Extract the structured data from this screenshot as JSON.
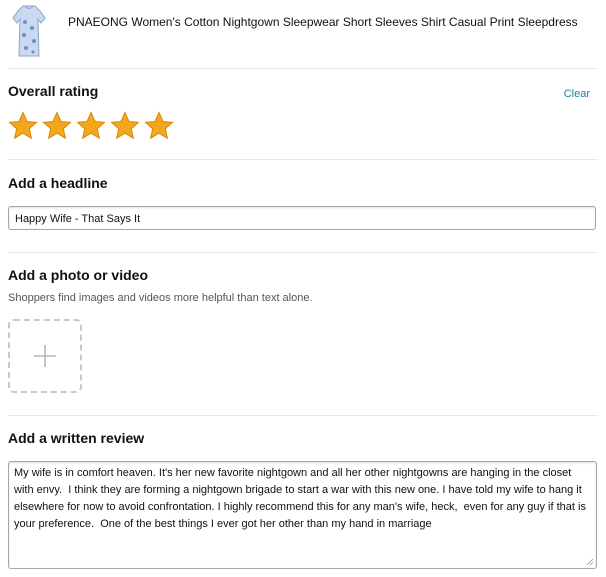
{
  "product": {
    "title": "PNAEONG Women's Cotton Nightgown Sleepwear Short Sleeves Shirt Casual Print Sleepdress",
    "image_icon": "nightgown-thumbnail"
  },
  "rating": {
    "heading": "Overall rating",
    "clear_label": "Clear",
    "stars_selected": 5,
    "stars_total": 5,
    "star_color": "#f3a81c"
  },
  "headline": {
    "heading": "Add a headline",
    "value": "Happy Wife - That Says It"
  },
  "media": {
    "heading": "Add a photo or video",
    "helper_text": "Shoppers find images and videos more helpful than text alone.",
    "upload_icon": "plus-icon"
  },
  "review": {
    "heading": "Add a written review",
    "value": "My wife is in comfort heaven. It's her new favorite nightgown and all her other nightgowns are hanging in the closet with envy.  I think they are forming a nightgown brigade to start a war with this new one. I have told my wife to hang it elsewhere for now to avoid confrontation. I highly recommend this for any man's wife, heck,  even for any guy if that is your preference.  One of the best things I ever got her other than my hand in marriage"
  },
  "colors": {
    "link": "#1b7f99",
    "divider": "#e7e7e7"
  }
}
